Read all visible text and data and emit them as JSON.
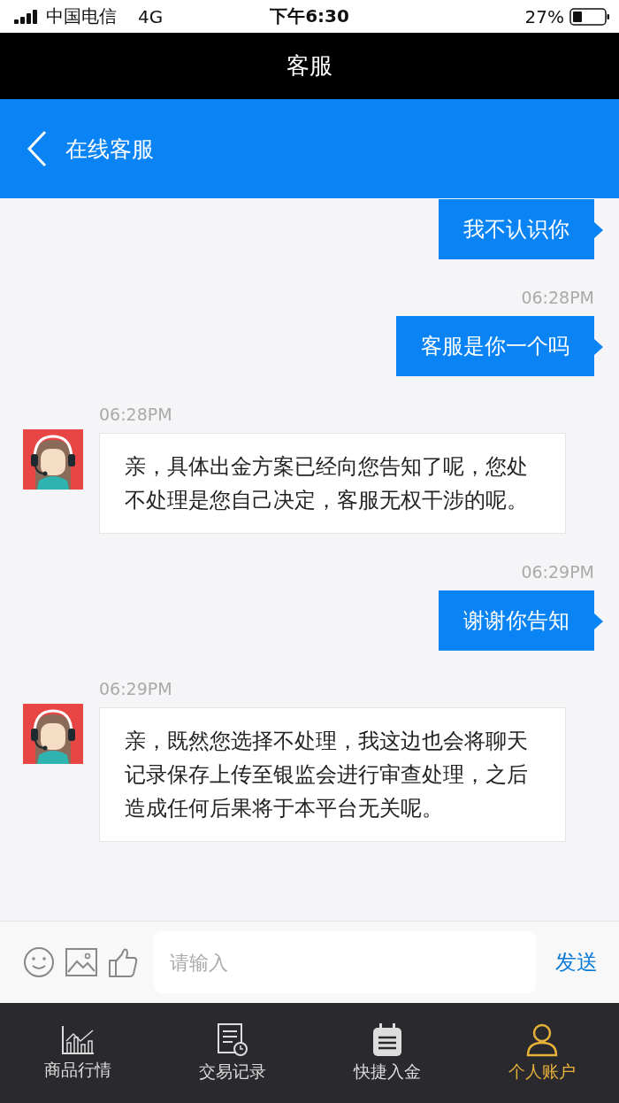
{
  "status_bar": {
    "carrier": "中国电信",
    "network": "4G",
    "time": "下午6:30",
    "battery": "27%"
  },
  "window": {
    "title": "客服"
  },
  "header": {
    "title": "在线客服"
  },
  "messages": [
    {
      "kind": "sent",
      "text": "我不认识你"
    },
    {
      "kind": "sent",
      "time": "06:28PM",
      "text": "客服是你一个吗"
    },
    {
      "kind": "received",
      "time": "06:28PM",
      "text": "亲，具体出金方案已经向您告知了呢，您处不处理是您自己决定，客服无权干涉的呢。"
    },
    {
      "kind": "sent",
      "time": "06:29PM",
      "text": "谢谢你告知"
    },
    {
      "kind": "received",
      "time": "06:29PM",
      "text": "亲，既然您选择不处理，我这边也会将聊天记录保存上传至银监会进行审查处理，之后造成任何后果将于本平台无关呢。"
    }
  ],
  "composer": {
    "placeholder": "请输入",
    "send": "发送"
  },
  "tabs": [
    {
      "label": "商品行情",
      "selected": false
    },
    {
      "label": "交易记录",
      "selected": false
    },
    {
      "label": "快捷入金",
      "selected": false
    },
    {
      "label": "个人账户",
      "selected": true
    }
  ]
}
